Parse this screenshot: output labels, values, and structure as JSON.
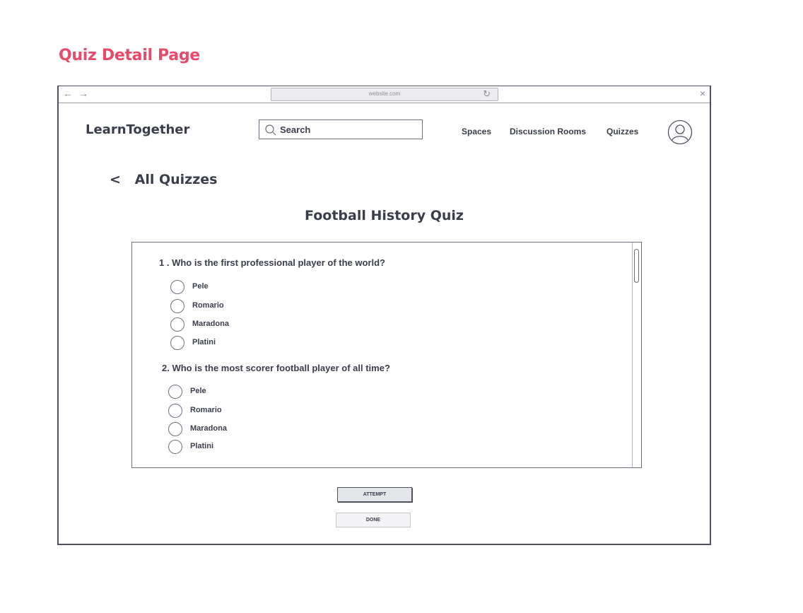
{
  "page_heading": "Quiz Detail Page",
  "browser": {
    "back_arrow": "←",
    "forward_arrow": "→",
    "url": "website.com",
    "reload_glyph": "↻",
    "close_glyph": "×"
  },
  "header": {
    "brand": "LearnTogether",
    "search_label": "Search",
    "nav": [
      "Spaces",
      "Discussion Rooms",
      "Quizzes"
    ]
  },
  "back_link": {
    "chevron": "<",
    "label": "All Quizzes"
  },
  "quiz": {
    "title": "Football History Quiz",
    "questions": [
      {
        "text": "1 . Who is the first professional player of the world?",
        "options": [
          "Pele",
          "Romario",
          "Maradona",
          "Platini"
        ]
      },
      {
        "text": "2. Who is the most scorer football player of all time?",
        "options": [
          "Pele",
          "Romario",
          "Maradona",
          "Platini"
        ]
      }
    ]
  },
  "actions": {
    "attempt_label": "ATTEMPT",
    "done_label": "DONE"
  },
  "colors": {
    "accent": "#e84a6a",
    "ink": "#3a3d4a",
    "frame": "#4d5160"
  }
}
